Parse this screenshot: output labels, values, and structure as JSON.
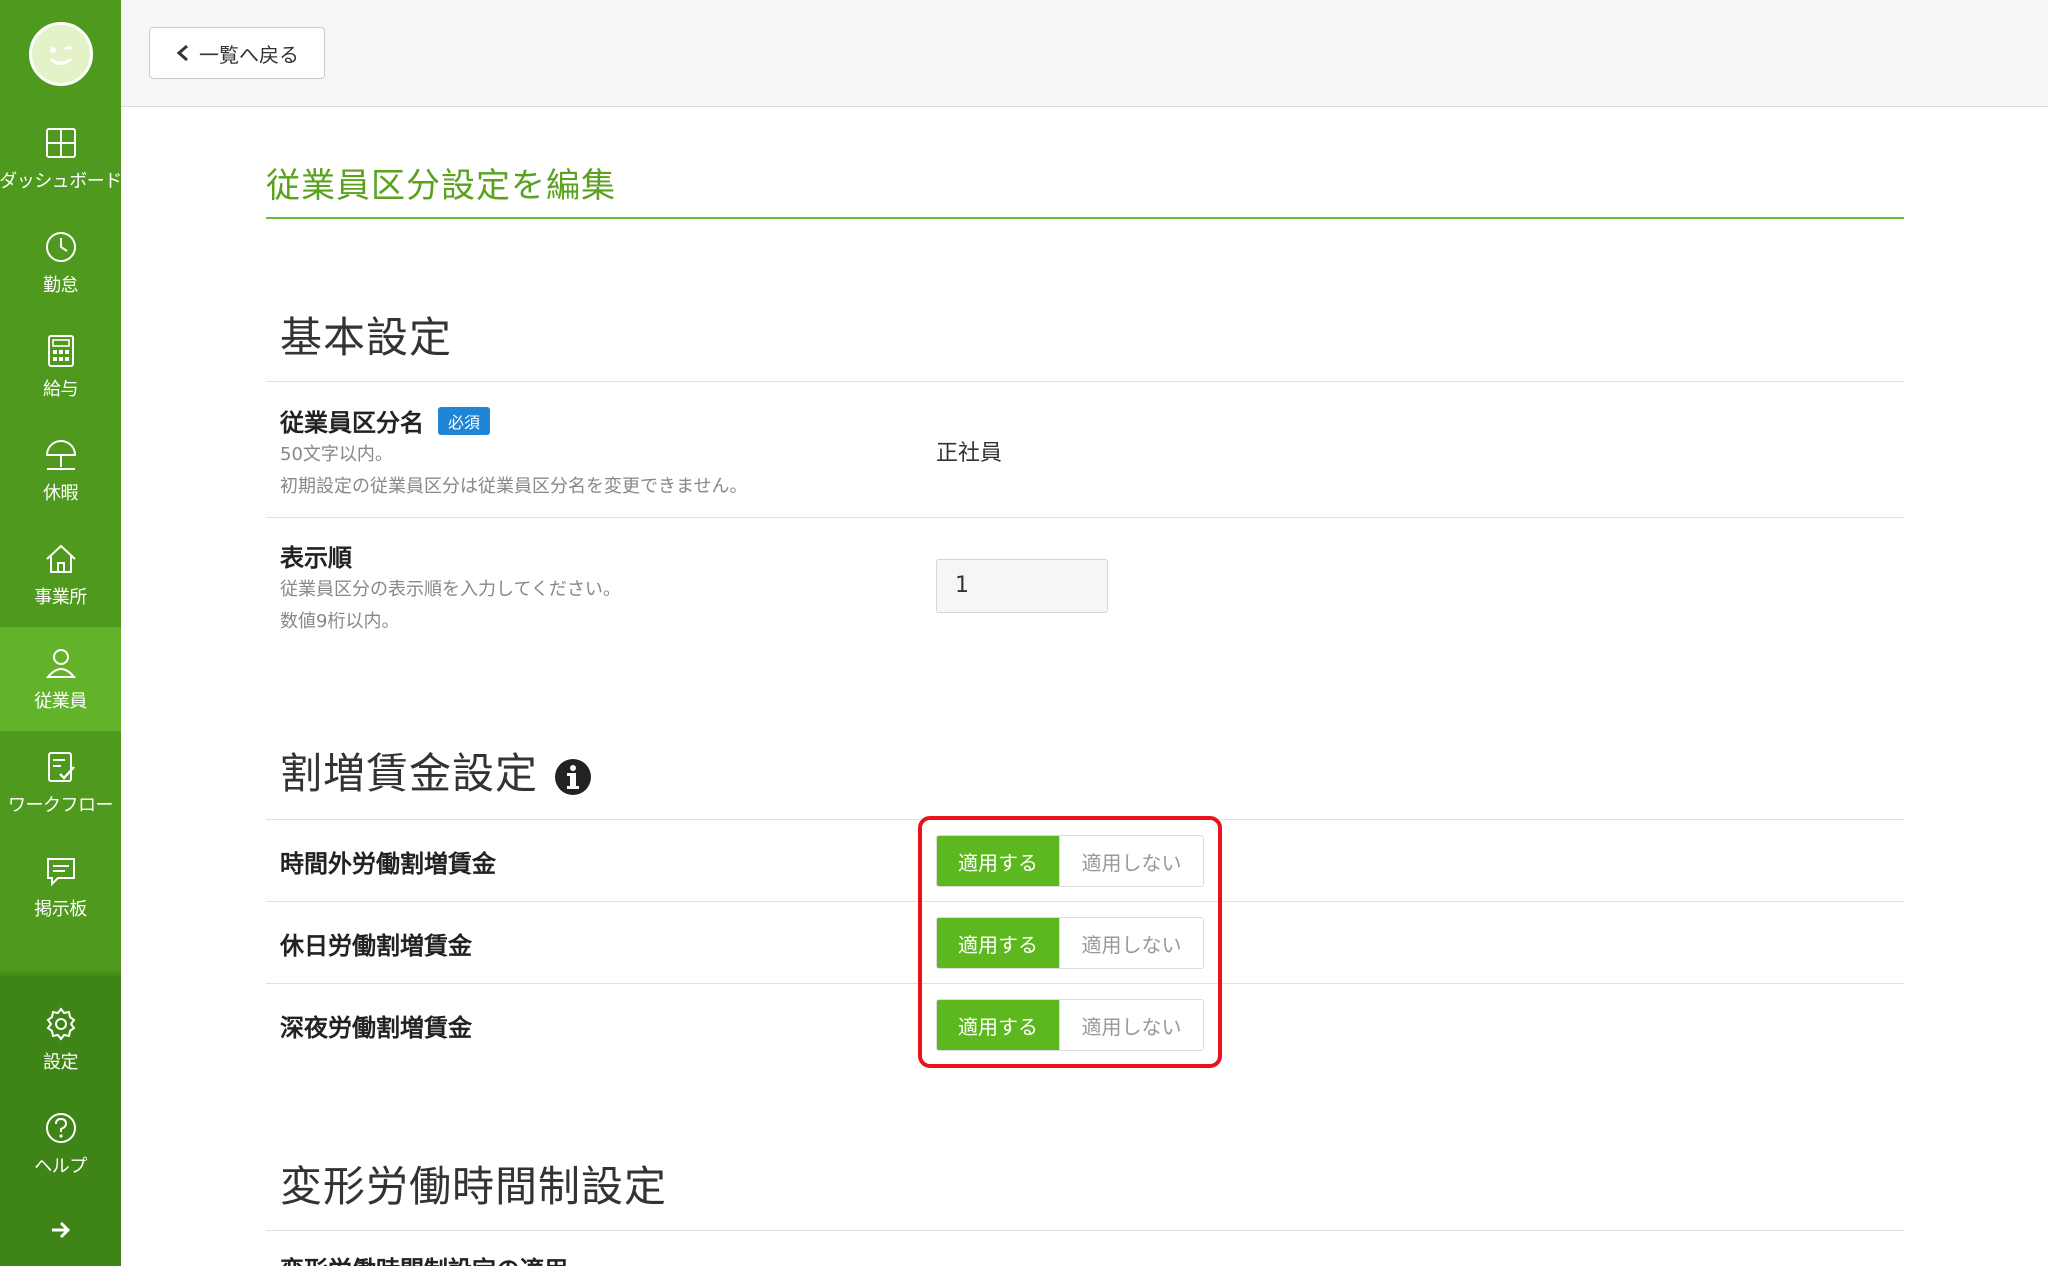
{
  "sidebar": {
    "items": [
      {
        "label": "ダッシュボード",
        "icon": "dashboard-icon"
      },
      {
        "label": "勤怠",
        "icon": "clock-icon"
      },
      {
        "label": "給与",
        "icon": "calculator-icon"
      },
      {
        "label": "休暇",
        "icon": "umbrella-icon"
      },
      {
        "label": "事業所",
        "icon": "home-icon"
      },
      {
        "label": "従業員",
        "icon": "person-icon"
      },
      {
        "label": "ワークフロー",
        "icon": "workflow-icon"
      },
      {
        "label": "掲示板",
        "icon": "chat-icon"
      }
    ],
    "bottom": [
      {
        "label": "設定",
        "icon": "gear-icon"
      },
      {
        "label": "ヘルプ",
        "icon": "help-icon"
      }
    ],
    "active_item": "従業員"
  },
  "topbar": {
    "back_label": "一覧へ戻る"
  },
  "page": {
    "title": "従業員区分設定を編集"
  },
  "basic": {
    "heading": "基本設定",
    "name_label": "従業員区分名",
    "required_badge": "必須",
    "name_help1": "50文字以内。",
    "name_help2": "初期設定の従業員区分は従業員区分名を変更できません。",
    "name_value": "正社員",
    "order_label": "表示順",
    "order_help1": "従業員区分の表示順を入力してください。",
    "order_help2": "数値9桁以内。",
    "order_value": "1"
  },
  "premium": {
    "heading": "割増賃金設定",
    "rows": [
      {
        "label": "時間外労働割増賃金",
        "on": "適用する",
        "off": "適用しない"
      },
      {
        "label": "休日労働割増賃金",
        "on": "適用する",
        "off": "適用しない"
      },
      {
        "label": "深夜労働割増賃金",
        "on": "適用する",
        "off": "適用しない"
      }
    ]
  },
  "variable": {
    "heading": "変形労働時間制設定",
    "row_label": "変形労働時間制設定の適用"
  }
}
